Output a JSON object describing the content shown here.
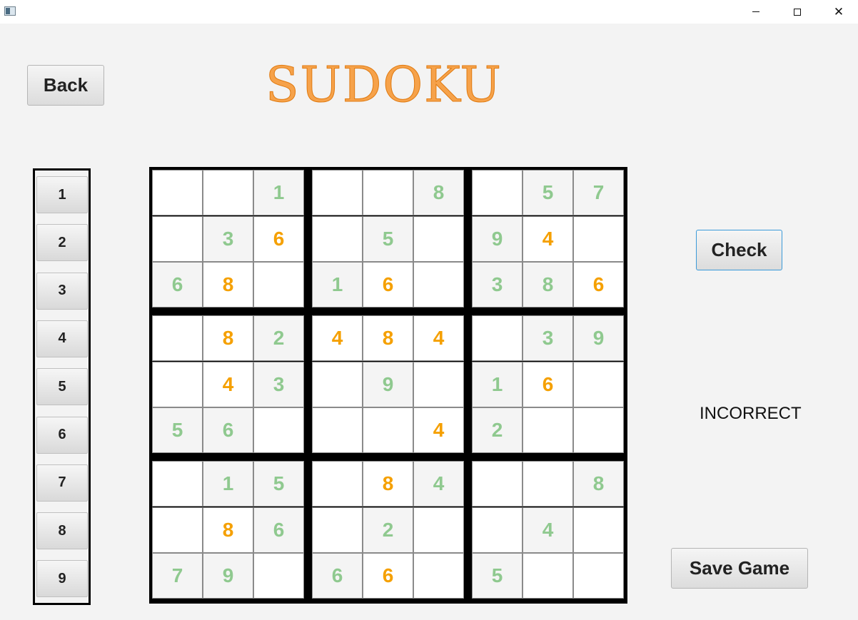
{
  "window": {
    "minimize_glyph": "",
    "maximize_glyph": "",
    "close_glyph": "✕"
  },
  "title": "SUDOKU",
  "buttons": {
    "back": "Back",
    "check": "Check",
    "save": "Save Game"
  },
  "status": "INCORRECT",
  "number_pad": [
    "1",
    "2",
    "3",
    "4",
    "5",
    "6",
    "7",
    "8",
    "9"
  ],
  "colors": {
    "given_digit": "#8fc98f",
    "user_digit": "#f5a000",
    "title": "#f6a24a"
  },
  "board": [
    [
      {
        "v": "",
        "t": "e"
      },
      {
        "v": "",
        "t": "e"
      },
      {
        "v": "1",
        "t": "g"
      },
      {
        "v": "",
        "t": "e"
      },
      {
        "v": "",
        "t": "e"
      },
      {
        "v": "8",
        "t": "g"
      },
      {
        "v": "",
        "t": "e"
      },
      {
        "v": "5",
        "t": "g"
      },
      {
        "v": "7",
        "t": "g"
      }
    ],
    [
      {
        "v": "",
        "t": "e"
      },
      {
        "v": "3",
        "t": "g"
      },
      {
        "v": "6",
        "t": "u"
      },
      {
        "v": "",
        "t": "e"
      },
      {
        "v": "5",
        "t": "g"
      },
      {
        "v": "",
        "t": "e"
      },
      {
        "v": "9",
        "t": "g"
      },
      {
        "v": "4",
        "t": "u"
      },
      {
        "v": "",
        "t": "e"
      }
    ],
    [
      {
        "v": "6",
        "t": "g"
      },
      {
        "v": "8",
        "t": "u"
      },
      {
        "v": "",
        "t": "e"
      },
      {
        "v": "1",
        "t": "g"
      },
      {
        "v": "6",
        "t": "u"
      },
      {
        "v": "",
        "t": "e"
      },
      {
        "v": "3",
        "t": "g"
      },
      {
        "v": "8",
        "t": "g"
      },
      {
        "v": "6",
        "t": "u"
      }
    ],
    [
      {
        "v": "",
        "t": "e"
      },
      {
        "v": "8",
        "t": "u"
      },
      {
        "v": "2",
        "t": "g"
      },
      {
        "v": "4",
        "t": "u"
      },
      {
        "v": "8",
        "t": "u"
      },
      {
        "v": "4",
        "t": "u"
      },
      {
        "v": "",
        "t": "e"
      },
      {
        "v": "3",
        "t": "g"
      },
      {
        "v": "9",
        "t": "g"
      }
    ],
    [
      {
        "v": "",
        "t": "e"
      },
      {
        "v": "4",
        "t": "u"
      },
      {
        "v": "3",
        "t": "g"
      },
      {
        "v": "",
        "t": "e"
      },
      {
        "v": "9",
        "t": "g"
      },
      {
        "v": "",
        "t": "e"
      },
      {
        "v": "1",
        "t": "g"
      },
      {
        "v": "6",
        "t": "u"
      },
      {
        "v": "",
        "t": "e"
      }
    ],
    [
      {
        "v": "5",
        "t": "g"
      },
      {
        "v": "6",
        "t": "g"
      },
      {
        "v": "",
        "t": "e"
      },
      {
        "v": "",
        "t": "e"
      },
      {
        "v": "",
        "t": "e"
      },
      {
        "v": "4",
        "t": "u"
      },
      {
        "v": "2",
        "t": "g"
      },
      {
        "v": "",
        "t": "e"
      },
      {
        "v": "",
        "t": "e"
      }
    ],
    [
      {
        "v": "",
        "t": "e"
      },
      {
        "v": "1",
        "t": "g"
      },
      {
        "v": "5",
        "t": "g"
      },
      {
        "v": "",
        "t": "e"
      },
      {
        "v": "8",
        "t": "u"
      },
      {
        "v": "4",
        "t": "g"
      },
      {
        "v": "",
        "t": "e"
      },
      {
        "v": "",
        "t": "e"
      },
      {
        "v": "8",
        "t": "g"
      }
    ],
    [
      {
        "v": "",
        "t": "e"
      },
      {
        "v": "8",
        "t": "u"
      },
      {
        "v": "6",
        "t": "g"
      },
      {
        "v": "",
        "t": "e"
      },
      {
        "v": "2",
        "t": "g"
      },
      {
        "v": "",
        "t": "e"
      },
      {
        "v": "",
        "t": "e"
      },
      {
        "v": "4",
        "t": "g"
      },
      {
        "v": "",
        "t": "e"
      }
    ],
    [
      {
        "v": "7",
        "t": "g"
      },
      {
        "v": "9",
        "t": "g"
      },
      {
        "v": "",
        "t": "e"
      },
      {
        "v": "6",
        "t": "g"
      },
      {
        "v": "6",
        "t": "u"
      },
      {
        "v": "",
        "t": "e"
      },
      {
        "v": "5",
        "t": "g"
      },
      {
        "v": "",
        "t": "e"
      },
      {
        "v": "",
        "t": "e"
      }
    ]
  ]
}
